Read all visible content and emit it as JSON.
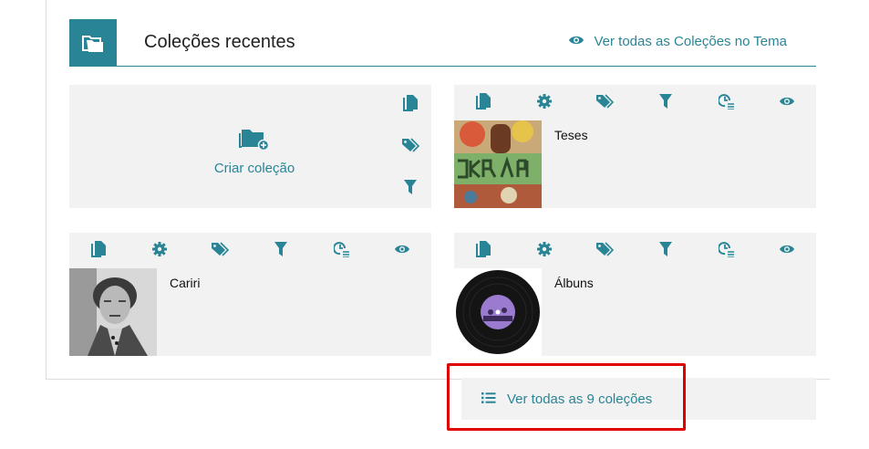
{
  "colors": {
    "accent": "#298596",
    "card_bg": "#f2f2f2",
    "highlight": "#e00000"
  },
  "header": {
    "title": "Coleções recentes",
    "see_all_theme": "Ver todas as Coleções no Tema",
    "icon": "folders-icon",
    "see_all_icon": "eye-icon"
  },
  "create_card": {
    "label": "Criar coleção",
    "icon": "folder-add-icon",
    "side_tools": [
      "copy-icon",
      "tags-icon",
      "filter-icon"
    ]
  },
  "collection_tools": [
    "copy-icon",
    "settings-icon",
    "tags-icon",
    "filter-icon",
    "activity-icon",
    "eye-icon"
  ],
  "collections": [
    {
      "title": "Teses"
    },
    {
      "title": "Cariri"
    },
    {
      "title": "Álbuns"
    }
  ],
  "footer": {
    "see_all_label": "Ver todas as 9 coleções",
    "icon": "list-icon"
  }
}
